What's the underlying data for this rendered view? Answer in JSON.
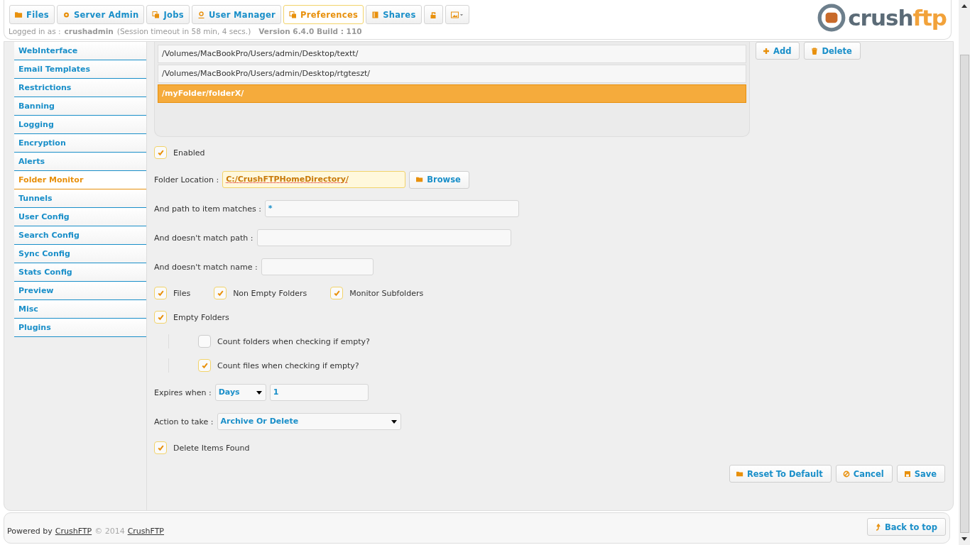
{
  "tabs": [
    {
      "label": "Files",
      "selected": false
    },
    {
      "label": "Server Admin",
      "selected": false
    },
    {
      "label": "Jobs",
      "selected": false
    },
    {
      "label": "User Manager",
      "selected": false
    },
    {
      "label": "Preferences",
      "selected": true
    },
    {
      "label": "Shares",
      "selected": false
    },
    {
      "selected": false
    },
    {
      "selected": false
    }
  ],
  "session": {
    "prefix": "Logged in as :",
    "user": "crushadmin",
    "timeout": "(Session timeout in 58 min, 4 secs.)",
    "version": "Version 6.4.0 Build : 110"
  },
  "logo": {
    "part_1": "crush",
    "part_2": "ftp"
  },
  "sidebar": {
    "items": [
      {
        "label": "WebInterface",
        "selected": false
      },
      {
        "label": "Email Templates",
        "selected": false
      },
      {
        "label": "Restrictions",
        "selected": false
      },
      {
        "label": "Banning",
        "selected": false
      },
      {
        "label": "Logging",
        "selected": false
      },
      {
        "label": "Encryption",
        "selected": false
      },
      {
        "label": "Alerts",
        "selected": false
      },
      {
        "label": "Folder Monitor",
        "selected": true
      },
      {
        "label": "Tunnels",
        "selected": false
      },
      {
        "label": "User Config",
        "selected": false
      },
      {
        "label": "Search Config",
        "selected": false
      },
      {
        "label": "Sync Config",
        "selected": false
      },
      {
        "label": "Stats Config",
        "selected": false
      },
      {
        "label": "Preview",
        "selected": false
      },
      {
        "label": "Misc",
        "selected": false
      },
      {
        "label": "Plugins",
        "selected": false
      }
    ]
  },
  "folder_list": [
    {
      "path": "/Volumes/MacBookPro/Users/admin/Desktop/textt/",
      "selected": false
    },
    {
      "path": "/Volumes/MacBookPro/Users/admin/Desktop/rtgteszt/",
      "selected": false
    },
    {
      "path": "/myFolder/folderX/",
      "selected": true
    }
  ],
  "list_buttons": [
    "Add",
    "Delete"
  ],
  "enabled": {
    "label": "Enabled",
    "checked": true
  },
  "folder_location": {
    "label": "Folder Location :",
    "value": "C:/CrushFTPHomeDirectory/",
    "button": "Browse"
  },
  "fields": [
    {
      "label": "And path to item matches :",
      "value": "*"
    },
    {
      "label": "And doesn't match path :"
    },
    {
      "label": "And doesn't match name :"
    }
  ],
  "types": [
    {
      "label": "Files",
      "checked": true
    },
    {
      "label": "Non Empty Folders",
      "checked": true
    },
    {
      "label": "Monitor Subfolders",
      "checked": true
    }
  ],
  "empty_folders": {
    "label": "Empty Folders",
    "checked": true
  },
  "empty_options": [
    {
      "label": "Count folders when checking if empty?",
      "checked": false
    },
    {
      "label": "Count files when checking if empty?",
      "checked": true
    }
  ],
  "expires": {
    "label": "Expires when :",
    "unit": "Days",
    "amount": "1"
  },
  "action": {
    "label": "Action to take :",
    "value": "Archive Or Delete"
  },
  "delete_items": {
    "label": "Delete Items Found",
    "checked": true
  },
  "buttons": [
    "Reset To Default",
    "Cancel",
    "Save"
  ],
  "footer": {
    "prefix": "Powered by",
    "link_1": "CrushFTP",
    "middle": "© 2014",
    "link_2": "CrushFTP",
    "back": "Back to top"
  }
}
